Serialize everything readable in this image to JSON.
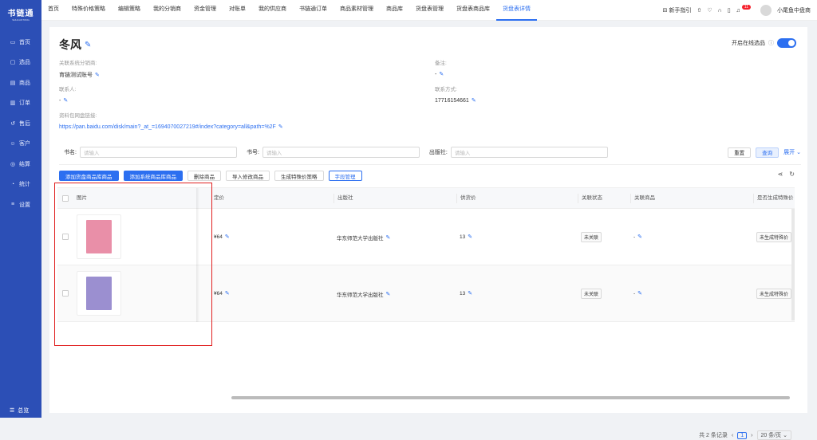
{
  "sidebar": {
    "logo": "书链通",
    "logo_sub": "SHULIANTONG",
    "items": [
      {
        "label": "首页",
        "icon": "monitor-icon"
      },
      {
        "label": "选品",
        "icon": "select-icon"
      },
      {
        "label": "商品",
        "icon": "goods-icon"
      },
      {
        "label": "订单",
        "icon": "order-icon"
      },
      {
        "label": "售后",
        "icon": "aftersale-icon"
      },
      {
        "label": "客户",
        "icon": "customer-icon"
      },
      {
        "label": "结算",
        "icon": "settle-icon"
      },
      {
        "label": "统计",
        "icon": "stats-icon"
      },
      {
        "label": "设置",
        "icon": "settings-icon"
      }
    ],
    "bottom_label": "总览"
  },
  "topnav": {
    "items": [
      "首页",
      "特殊价格策略",
      "编辑策略",
      "我的分销商",
      "资金管理",
      "对账单",
      "我的供应商",
      "书链通订单",
      "商品素材管理",
      "商品库",
      "货盘表管理",
      "货盘表商品库",
      "货盘表详情"
    ],
    "active_index": 12,
    "guide": "新手指引",
    "badge": "11",
    "user": "小尾鱼中盘商"
  },
  "page": {
    "title": "冬风",
    "online_toggle_label": "开启在线选品",
    "online_toggle_on": true,
    "fields": {
      "distributor_label": "关联系统分销商:",
      "distributor_value": "育链测试账号",
      "remark_label": "备注:",
      "remark_value": "-",
      "contact_label": "联系人:",
      "contact_value": "-",
      "phone_label": "联系方式:",
      "phone_value": "17716154661",
      "netdisk_label": "资料包网盘链接:",
      "netdisk_value": "https://pan.baidu.com/disk/main?_at_=1694070027219#/index?category=all&path=%2F"
    }
  },
  "filters": {
    "book_name_label": "书名:",
    "book_name_placeholder": "请输入",
    "book_no_label": "书号:",
    "book_no_placeholder": "请输入",
    "publisher_label": "出版社:",
    "publisher_placeholder": "请输入",
    "reset": "重置",
    "search": "查询",
    "expand": "展开"
  },
  "actions": {
    "add_pallet": "添加货盘商品库商品",
    "add_system": "添加系统商品库商品",
    "delete": "删除商品",
    "import": "导入修改商品",
    "gen_price": "生成特殊价策略",
    "field_manage": "字段管理"
  },
  "table": {
    "columns": {
      "image": "图片",
      "price": "定价",
      "publisher": "出版社",
      "supply_price": "供货价",
      "link_status": "关联状态",
      "link_goods": "关联商品",
      "special": "是否生成特殊价"
    },
    "rows": [
      {
        "price": "¥64",
        "publisher": "华东师范大学出版社",
        "supply": "13",
        "status": "未关联",
        "goods": "-",
        "special": "未生成特殊价",
        "cover": "#e98fa8"
      },
      {
        "price": "¥64",
        "publisher": "华东师范大学出版社",
        "supply": "13",
        "status": "未关联",
        "goods": "-",
        "special": "未生成特殊价",
        "cover": "#9b8fd0"
      }
    ]
  },
  "pager": {
    "total": "共 2 条记录",
    "current": "1",
    "page_size": "20 条/页"
  }
}
